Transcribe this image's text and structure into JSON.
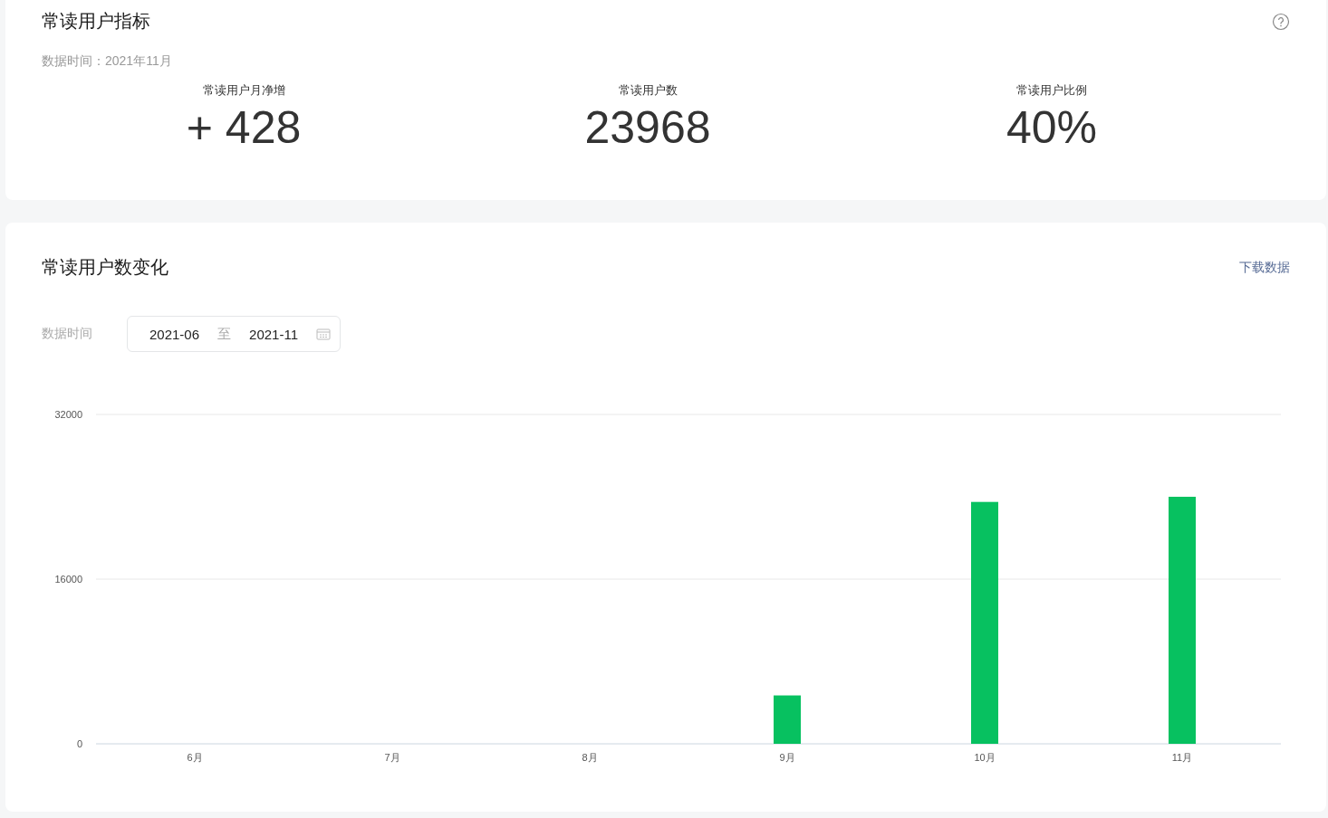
{
  "indicators": {
    "title": "常读用户指标",
    "data_time": "数据时间：2021年11月",
    "metrics": [
      {
        "label": "常读用户月净增",
        "value": "+ 428"
      },
      {
        "label": "常读用户数",
        "value": "23968"
      },
      {
        "label": "常读用户比例",
        "value": "40%"
      }
    ]
  },
  "trend": {
    "title": "常读用户数变化",
    "download": "下载数据",
    "range_label": "数据时间",
    "start": "2021-06",
    "separator": "至",
    "end": "2021-11",
    "chart_data": {
      "type": "bar",
      "categories": [
        "6月",
        "7月",
        "8月",
        "9月",
        "10月",
        "11月"
      ],
      "values": [
        0,
        0,
        0,
        4700,
        23500,
        24000
      ],
      "ylim": [
        0,
        32000
      ],
      "yticks": [
        0,
        16000,
        32000
      ]
    }
  }
}
